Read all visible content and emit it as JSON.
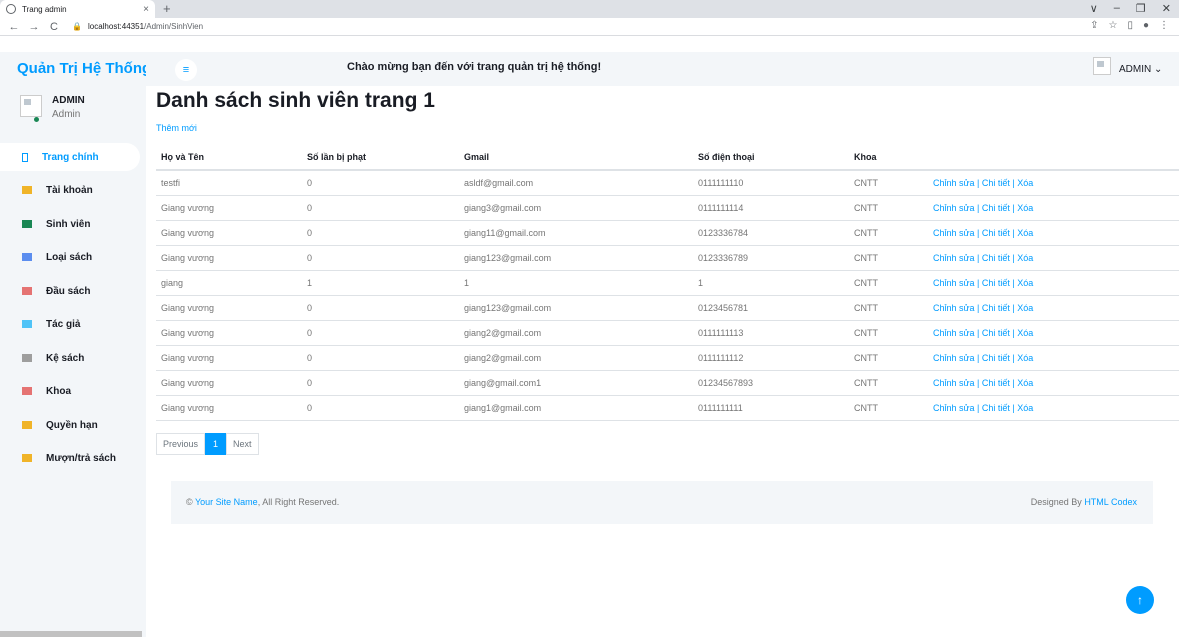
{
  "browser": {
    "tab_title": "Trang admin",
    "tab_close": "×",
    "new_tab": "+",
    "url_host": "localhost:44351",
    "url_path": "/Admin/SinhVien",
    "controls": [
      "∨",
      "–",
      "❐",
      "✕"
    ]
  },
  "brand": "Quản Trị Hệ Thống",
  "header": {
    "welcome": "Chào mừng bạn đến với trang quản trị hệ thống!",
    "admin_label": "ADMIN ⌄"
  },
  "user": {
    "name": "ADMIN",
    "role": "Admin"
  },
  "sidebar": {
    "items": [
      {
        "label": "Trang chính",
        "icon": "home-icon",
        "color": "#009cff",
        "active": true
      },
      {
        "label": "Tài khoản",
        "icon": "grid-icon",
        "color": "#f0b429",
        "active": false
      },
      {
        "label": "Sinh viên",
        "icon": "grid-icon",
        "color": "#198754",
        "active": false
      },
      {
        "label": "Loại sách",
        "icon": "chart-icon",
        "color": "#5b8def",
        "active": false
      },
      {
        "label": "Đầu sách",
        "icon": "keyboard-icon",
        "color": "#e57373",
        "active": false
      },
      {
        "label": "Tác giả",
        "icon": "keyboard-icon",
        "color": "#4fc3f7",
        "active": false
      },
      {
        "label": "Kệ sách",
        "icon": "keyboard-icon",
        "color": "#9e9e9e",
        "active": false
      },
      {
        "label": "Khoa",
        "icon": "keyboard-icon",
        "color": "#e57373",
        "active": false
      },
      {
        "label": "Quyền hạn",
        "icon": "table-icon",
        "color": "#f0b429",
        "active": false
      },
      {
        "label": "Mượn/trả sách",
        "icon": "table-icon",
        "color": "#f0b429",
        "active": false
      }
    ]
  },
  "main": {
    "title": "Danh sách sinh viên trang 1",
    "add_new": "Thêm mới",
    "columns": [
      "Họ và Tên",
      "Số lần bị phạt",
      "Gmail",
      "Số điện thoại",
      "Khoa",
      ""
    ],
    "rows": [
      [
        "testfi",
        "0",
        "asldf@gmail.com",
        "0111111110",
        "CNTT",
        "Chỉnh sửa | Chi tiết | Xóa"
      ],
      [
        "Giang vương",
        "0",
        "giang3@gmail.com",
        "0111111114",
        "CNTT",
        "Chỉnh sửa | Chi tiết | Xóa"
      ],
      [
        "Giang vương",
        "0",
        "giang11@gmail.com",
        "0123336784",
        "CNTT",
        "Chỉnh sửa | Chi tiết | Xóa"
      ],
      [
        "Giang vương",
        "0",
        "giang123@gmail.com",
        "0123336789",
        "CNTT",
        "Chỉnh sửa | Chi tiết | Xóa"
      ],
      [
        "giang",
        "1",
        "1",
        "1",
        "CNTT",
        "Chỉnh sửa | Chi tiết | Xóa"
      ],
      [
        "Giang vương",
        "0",
        "giang123@gmail.com",
        "0123456781",
        "CNTT",
        "Chỉnh sửa | Chi tiết | Xóa"
      ],
      [
        "Giang vương",
        "0",
        "giang2@gmail.com",
        "0111111113",
        "CNTT",
        "Chỉnh sửa | Chi tiết | Xóa"
      ],
      [
        "Giang vương",
        "0",
        "giang2@gmail.com",
        "0111111112",
        "CNTT",
        "Chỉnh sửa | Chi tiết | Xóa"
      ],
      [
        "Giang vương",
        "0",
        "giang@gmail.com1",
        "01234567893",
        "CNTT",
        "Chỉnh sửa | Chi tiết | Xóa"
      ],
      [
        "Giang vương",
        "0",
        "giang1@gmail.com",
        "0111111111",
        "CNTT",
        "Chỉnh sửa | Chi tiết | Xóa"
      ]
    ],
    "pagination": {
      "prev": "Previous",
      "current": "1",
      "next": "Next"
    }
  },
  "footer": {
    "copyright_symbol": "©",
    "site_name": "Your Site Name",
    "rights": ", All Right Reserved.",
    "designed_by": "Designed By",
    "designer": "HTML Codex"
  },
  "back_to_top": "↑"
}
